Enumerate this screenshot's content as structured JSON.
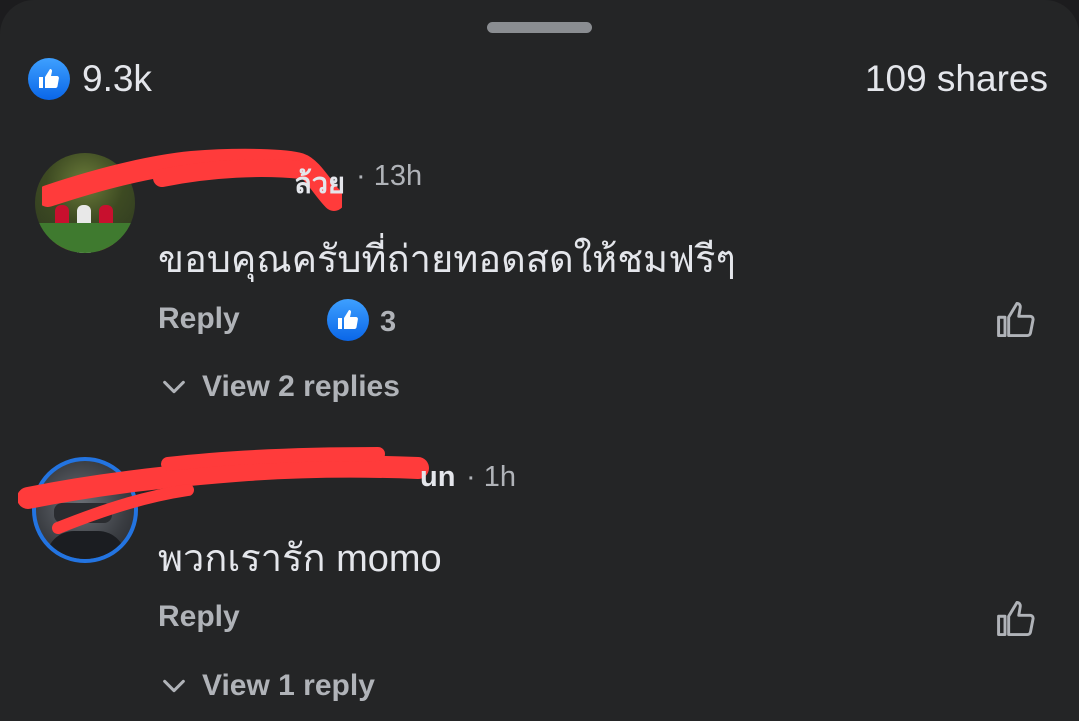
{
  "reactions": {
    "like_count": "9.3k",
    "shares": "109 shares",
    "icon": "thumbs-up-icon",
    "accent": "#1877f2"
  },
  "comments": [
    {
      "name_visible": "ล้วย",
      "time": "· 13h",
      "text": "ขอบคุณครับที่ถ่ายทอดสดให้ชมฟรีๆ",
      "reply_label": "Reply",
      "reaction_count": "3",
      "view_replies": "View 2 replies"
    },
    {
      "name_visible": "un",
      "time": "· 1h",
      "text": "พวกเรารัก momo",
      "reply_label": "Reply",
      "view_replies": "View 1 reply"
    }
  ]
}
